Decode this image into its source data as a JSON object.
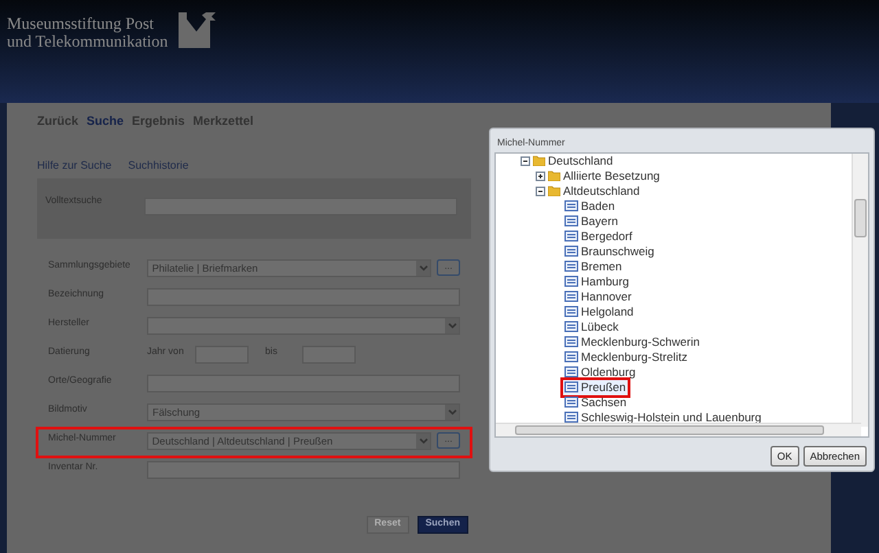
{
  "header": {
    "title_lines": [
      "Museumsstiftung Post",
      "und Telekommunikation"
    ]
  },
  "nav": [
    {
      "label": "Zurück",
      "selected": false
    },
    {
      "label": "Suche",
      "selected": true
    },
    {
      "label": "Ergebnis",
      "selected": false
    },
    {
      "label": "Merkzettel",
      "selected": false
    }
  ],
  "links": [
    "Hilfe zur Suche",
    "Suchhistorie"
  ],
  "fulltext": {
    "label": "Volltextsuche"
  },
  "fields": [
    {
      "kind": "picker",
      "label": "Sammlungsgebiete",
      "value": "Philatelie | Briefmarken",
      "button": "...",
      "highlighted": false
    },
    {
      "kind": "text",
      "label": "Bezeichnung",
      "highlighted": false
    },
    {
      "kind": "select",
      "label": "Hersteller",
      "highlighted": false
    },
    {
      "kind": "range",
      "label": "Datierung",
      "from_label": "Jahr von",
      "to_label": "bis",
      "highlighted": false
    },
    {
      "kind": "text",
      "label": "Orte/Geografie",
      "highlighted": false
    },
    {
      "kind": "select",
      "label": "Bildmotiv",
      "value": "Fälschung",
      "highlighted": false
    },
    {
      "kind": "picker",
      "label": "Michel-Nummer",
      "value": "Deutschland | Altdeutschland | Preußen",
      "button": "...",
      "highlighted": true
    },
    {
      "kind": "text",
      "label": "Inventar Nr.",
      "highlighted": false
    }
  ],
  "actions": [
    {
      "label": "Reset",
      "disabled": true
    },
    {
      "label": "Suchen",
      "disabled": false
    }
  ],
  "dialog": {
    "title": "Michel-Nummer",
    "tree": [
      {
        "label": "Deutschland",
        "kind": "folder",
        "expanded": true,
        "children": [
          {
            "label": "Alliierte Besetzung",
            "kind": "folder",
            "expanded": false
          },
          {
            "label": "Altdeutschland",
            "kind": "folder",
            "expanded": true,
            "children": [
              {
                "label": "Baden",
                "kind": "leaf",
                "selected": false
              },
              {
                "label": "Bayern",
                "kind": "leaf",
                "selected": false
              },
              {
                "label": "Bergedorf",
                "kind": "leaf",
                "selected": false
              },
              {
                "label": "Braunschweig",
                "kind": "leaf",
                "selected": false
              },
              {
                "label": "Bremen",
                "kind": "leaf",
                "selected": false
              },
              {
                "label": "Hamburg",
                "kind": "leaf",
                "selected": false
              },
              {
                "label": "Hannover",
                "kind": "leaf",
                "selected": false
              },
              {
                "label": "Helgoland",
                "kind": "leaf",
                "selected": false
              },
              {
                "label": "Lübeck",
                "kind": "leaf",
                "selected": false
              },
              {
                "label": "Mecklenburg-Schwerin",
                "kind": "leaf",
                "selected": false
              },
              {
                "label": "Mecklenburg-Strelitz",
                "kind": "leaf",
                "selected": false
              },
              {
                "label": "Oldenburg",
                "kind": "leaf",
                "selected": false
              },
              {
                "label": "Preußen",
                "kind": "leaf",
                "selected": true
              },
              {
                "label": "Sachsen",
                "kind": "leaf",
                "selected": false
              },
              {
                "label": "Schleswig-Holstein und Lauenburg",
                "kind": "leaf",
                "selected": false
              }
            ]
          }
        ]
      }
    ],
    "buttons": [
      "OK",
      "Abbrechen"
    ]
  }
}
